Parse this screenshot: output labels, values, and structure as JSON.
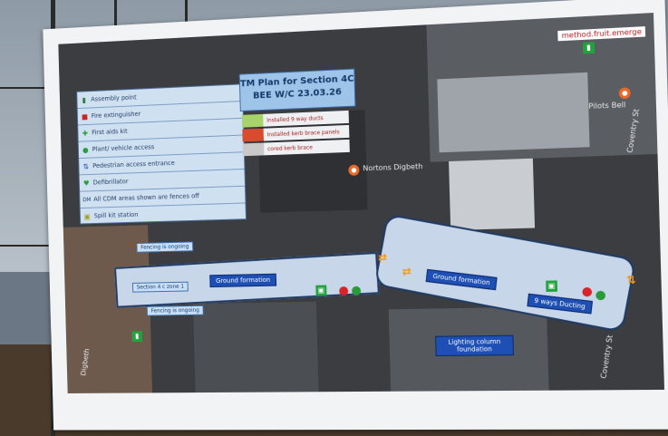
{
  "legend": {
    "items": [
      {
        "icon": "▮",
        "label": "Assembly point"
      },
      {
        "icon": "■",
        "label": "Fire extinguisher"
      },
      {
        "icon": "✚",
        "label": "First aids kit"
      },
      {
        "icon": "●",
        "label": "Plant/ vehicle access"
      },
      {
        "icon": "⇅",
        "label": "Pedestrian access  entrance"
      },
      {
        "icon": "♥",
        "label": "Defibrillator"
      },
      {
        "icon": "DM",
        "label": "All CDM areas shown are fences off"
      },
      {
        "icon": "▣",
        "label": "Spill kit station"
      }
    ]
  },
  "title": {
    "line1": "TM Plan for Section 4C",
    "line2": "BEE W/C 23.03.26"
  },
  "notes": [
    {
      "label": "Installed 9 way ducts",
      "color": "#a7d46a"
    },
    {
      "label": "Installed kerb brace panels",
      "color": "#d94b2e"
    },
    {
      "label": "cored kerb brace",
      "color": "#c9c9c9"
    }
  ],
  "map": {
    "labels": {
      "ground1": "Ground formation",
      "ground2": "Ground formation",
      "ducting": "9 ways Ducting",
      "lighting": "Lighting column foundation",
      "section": "Section 4 c zone 1",
      "fencing1": "Fencing is ongoing",
      "fencing2": "Fencing is ongoing"
    },
    "brand": "method.fruit.emerge",
    "places": [
      "Nortons Digbeth",
      "Pilots Bell"
    ],
    "streets": [
      "Coventry St",
      "Coventry St",
      "St",
      "Digbeth"
    ]
  },
  "colors": {
    "accent": "#1e4fb4",
    "legend_bg": "#cfe0f1",
    "title_bg": "#9fc4ea"
  }
}
